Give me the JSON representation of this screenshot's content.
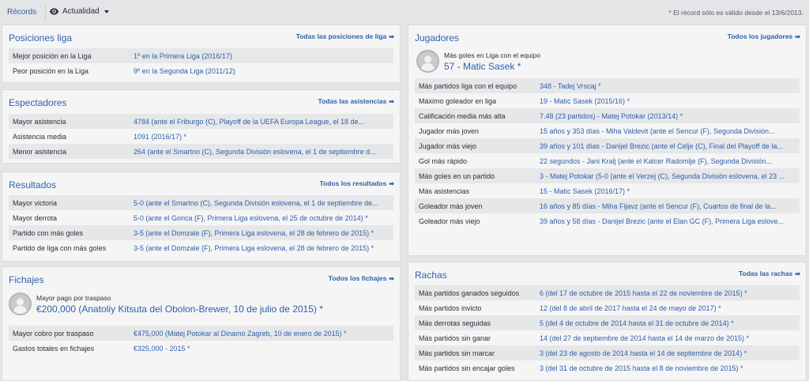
{
  "topbar": {
    "records_label": "Récords",
    "view_label": "Actualidad",
    "note": "* El récord sólo es válido desde el 13/6/2013."
  },
  "league": {
    "title": "Posiciones liga",
    "link": "Todas las posiciones de liga",
    "rows": [
      {
        "k": "Mejor posición en la Liga",
        "v": "1º en la Primera Liga (2016/17)"
      },
      {
        "k": "Peor posición en la Liga",
        "v": "9º en la Segunda Liga (2011/12)"
      }
    ]
  },
  "attendance": {
    "title": "Espectadores",
    "link": "Todas las asistencias",
    "rows": [
      {
        "k": "Mayor asistencia",
        "v": "4784 (ante el Friburgo (C), Playoff de la UEFA Europa League, el 18 de..."
      },
      {
        "k": "Asistencia media",
        "v": "1091 (2016/17) *"
      },
      {
        "k": "Menor asistencia",
        "v": "264 (ante el Smartno (C), Segunda División eslovena, el 1 de septiembre d..."
      }
    ]
  },
  "results": {
    "title": "Resultados",
    "link": "Todos los resultados",
    "rows": [
      {
        "k": "Mayor victoria",
        "v": "5-0 (ante el Smartno (C), Segunda División eslovena, el 1 de septiembre de..."
      },
      {
        "k": "Mayor derrota",
        "v": "5-0 (ante el Gorica (F), Primera Liga eslovena, el 25 de octubre de 2014) *"
      },
      {
        "k": "Partido con más goles",
        "v": "3-5 (ante el Domzale (F), Primera Liga eslovena, el 28 de febrero de 2015) *"
      },
      {
        "k": "Partido de liga con más goles",
        "v": "3-5 (ante el Domzale (F), Primera Liga eslovena, el 28 de febrero de 2015) *"
      }
    ]
  },
  "transfers": {
    "title": "Fichajes",
    "link": "Todos los fichajes",
    "feature_caption": "Mayor pago por traspaso",
    "feature_value": "€200,000 (Anatoliy Kitsuta del Obolon-Brewer, 10 de julio de 2015) *",
    "rows": [
      {
        "k": "Mayor cobro por traspaso",
        "v": "€475,000 (Matej Potokar al Dinamo Zagreb, 10 de enero de 2015) *"
      },
      {
        "k": "Gastos totales en fichajes",
        "v": "€325,000 - 2015 *"
      }
    ]
  },
  "players": {
    "title": "Jugadores",
    "link": "Todos los jugadores",
    "feature_caption": "Más goles en Liga con el equipo",
    "feature_value": "57 - Matic Sasek *",
    "rows": [
      {
        "k": "Más partidos liga con el equipo",
        "v": "348 - Tadej Vrscaj *"
      },
      {
        "k": "Máximo goleador en liga",
        "v": "19 - Matic Sasek (2015/16) *"
      },
      {
        "k": "Calificación media más alta",
        "v": "7.48 (23 partidos) - Matej Potokar (2013/14) *"
      },
      {
        "k": "Jugador más joven",
        "v": "15 años y 353 días - Miha Valdevit (ante el Sencur (F), Segunda División..."
      },
      {
        "k": "Jugador más viejo",
        "v": "39 años y 101 días - Danijel Brezic (ante el Celje (C), Final del Playoff de la..."
      },
      {
        "k": "Gol más rápido",
        "v": "22 segundos - Jani Kralj (ante el Kalcer Radomlje (F), Segunda División..."
      },
      {
        "k": "Más goles en un partido",
        "v": "3 - Matej Potokar (5-0 (ante el Verzej (C), Segunda División eslovena, el 23 ..."
      },
      {
        "k": "Más asistencias",
        "v": "15 - Matic Sasek (2016/17) *"
      },
      {
        "k": "Goleador más joven",
        "v": "16 años y 85 días - Miha Fijavz (ante el Sencur (F), Cuartos de final de la..."
      },
      {
        "k": "Goleador más viejo",
        "v": "39 años y 58 días - Danijel Brezic (ante el Elan GC (F), Primera Liga eslove..."
      }
    ]
  },
  "streaks": {
    "title": "Rachas",
    "link": "Todas las rachas",
    "rows": [
      {
        "k": "Más partidos ganados seguidos",
        "v": "6 (del 17 de octubre de 2015 hasta el 22 de noviembre de 2015) *"
      },
      {
        "k": "Más partidos invicto",
        "v": "12 (del 8 de abril de 2017 hasta el 24 de mayo de 2017) *"
      },
      {
        "k": "Más derrotas seguidas",
        "v": "5 (del 4 de octubre de 2014 hasta el 31 de octubre de 2014) *"
      },
      {
        "k": "Más partidos sin ganar",
        "v": "14 (del 27 de septiembre de 2014 hasta el 14 de marzo de 2015) *"
      },
      {
        "k": "Más partidos sin marcar",
        "v": "3 (del 23 de agosto de 2014 hasta el 14 de septiembre de 2014) *"
      },
      {
        "k": "Más partidos sin encajar goles",
        "v": "3 (del 31 de octubre de 2015 hasta el 8 de noviembre de 2015) *"
      }
    ]
  }
}
